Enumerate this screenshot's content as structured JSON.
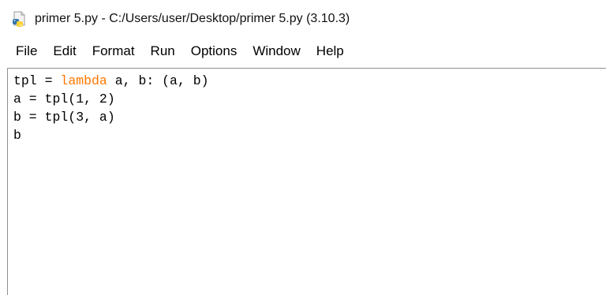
{
  "window": {
    "title": "primer 5.py - C:/Users/user/Desktop/primer 5.py (3.10.3)",
    "icon": "python-file-icon"
  },
  "menubar": {
    "items": [
      {
        "label": "File"
      },
      {
        "label": "Edit"
      },
      {
        "label": "Format"
      },
      {
        "label": "Run"
      },
      {
        "label": "Options"
      },
      {
        "label": "Window"
      },
      {
        "label": "Help"
      }
    ]
  },
  "editor": {
    "keyword_color": "#ff7700",
    "lines": [
      {
        "pre": "tpl = ",
        "kw": "lambda",
        "post": " a, b: (a, b)"
      },
      {
        "pre": "a = tpl(1, 2)",
        "kw": "",
        "post": ""
      },
      {
        "pre": "b = tpl(3, a)",
        "kw": "",
        "post": ""
      },
      {
        "pre": "b",
        "kw": "",
        "post": ""
      }
    ]
  }
}
